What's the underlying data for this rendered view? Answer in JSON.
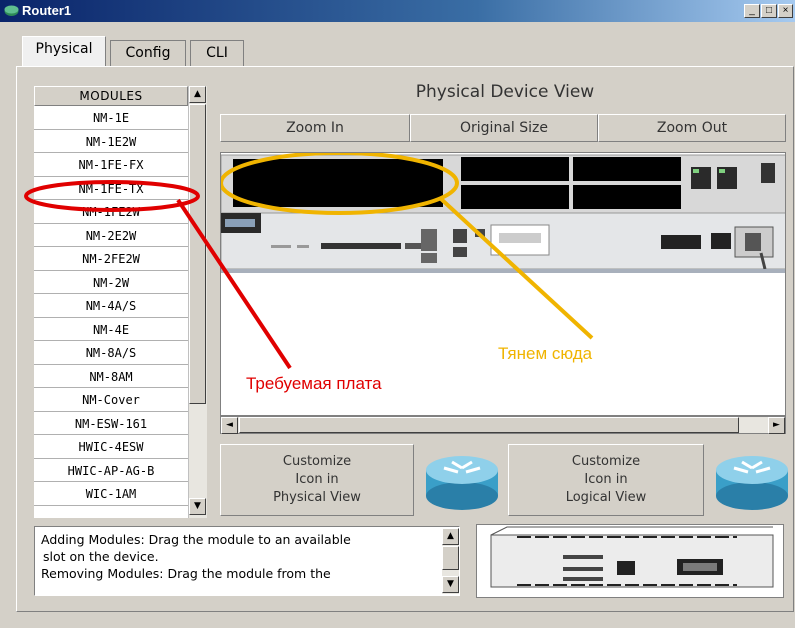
{
  "window": {
    "title": "Router1",
    "minimize": "_",
    "maximize": "□",
    "close": "×"
  },
  "tabs": [
    {
      "label": "Physical"
    },
    {
      "label": "Config"
    },
    {
      "label": "CLI"
    }
  ],
  "modules": {
    "header": "MODULES",
    "items": [
      "NM-1E",
      "NM-1E2W",
      "NM-1FE-FX",
      "NM-1FE-TX",
      "NM-1FE2W",
      "NM-2E2W",
      "NM-2FE2W",
      "NM-2W",
      "NM-4A/S",
      "NM-4E",
      "NM-8A/S",
      "NM-8AM",
      "NM-Cover",
      "NM-ESW-161",
      "HWIC-4ESW",
      "HWIC-AP-AG-B",
      "WIC-1AM"
    ],
    "highlighted": "NM-1FE-TX"
  },
  "device_view": {
    "title": "Physical Device View",
    "zoom_in": "Zoom In",
    "original_size": "Original Size",
    "zoom_out": "Zoom Out"
  },
  "customize": {
    "physical": [
      "Customize",
      "Icon in",
      "Physical View"
    ],
    "logical": [
      "Customize",
      "Icon in",
      "Logical View"
    ]
  },
  "info_text": [
    "Adding Modules: Drag the module to an available",
    "slot on the device.",
    "Removing Modules: Drag the module from the"
  ],
  "annotations": {
    "required_board": "Требуемая плата",
    "drag_here": "Тянем сюда",
    "red": "#e00000",
    "yellow": "#f0b400"
  }
}
